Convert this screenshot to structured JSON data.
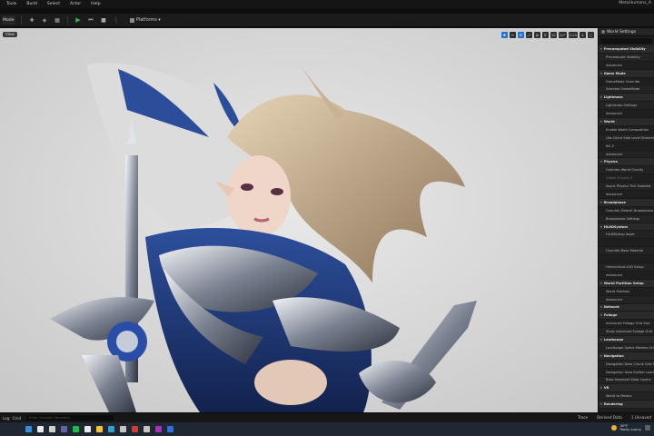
{
  "menubar": {
    "items": [
      "Tools",
      "Build",
      "Select",
      "Actor",
      "Help"
    ],
    "title": "MetaHumans_A"
  },
  "toolbar": {
    "mode_label": "Mode",
    "platforms_label": "Platforms"
  },
  "viewport": {
    "view_label": "View",
    "tools": [
      "10",
      "10°",
      "0.25",
      "4"
    ]
  },
  "panel": {
    "title": "World Settings",
    "rows": [
      {
        "t": "section",
        "label": "Precomputed Visibility"
      },
      {
        "t": "item",
        "label": "Precompute Visibility"
      },
      {
        "t": "item",
        "label": "Advanced"
      },
      {
        "t": "section",
        "label": "Game Mode"
      },
      {
        "t": "item",
        "label": "GameMode Override"
      },
      {
        "t": "item",
        "label": "Selected GameMode"
      },
      {
        "t": "section",
        "label": "Lightmass"
      },
      {
        "t": "item",
        "label": "Lightmass Settings"
      },
      {
        "t": "item",
        "label": "Advanced"
      },
      {
        "t": "section",
        "label": "World"
      },
      {
        "t": "item",
        "label": "Enable World Composition"
      },
      {
        "t": "item",
        "label": "Use Client Side Level Streaming"
      },
      {
        "t": "item",
        "label": "Kill Z"
      },
      {
        "t": "item",
        "label": "Advanced"
      },
      {
        "t": "section",
        "label": "Physics"
      },
      {
        "t": "item",
        "label": "Override World Gravity"
      },
      {
        "t": "item",
        "label": "Global Gravity Z",
        "dim": true
      },
      {
        "t": "item",
        "label": "Async Physics Tick Enabled"
      },
      {
        "t": "item",
        "label": "Advanced"
      },
      {
        "t": "section",
        "label": "Broadphase"
      },
      {
        "t": "item",
        "label": "Override Default Broadphase Se"
      },
      {
        "t": "item",
        "label": "Broadphase Settings"
      },
      {
        "t": "section",
        "label": "HLODSystem"
      },
      {
        "t": "item",
        "label": "HLODSetup Asset"
      },
      {
        "t": "item",
        "label": ""
      },
      {
        "t": "item",
        "label": "Override Base Material"
      },
      {
        "t": "item",
        "label": ""
      },
      {
        "t": "item",
        "label": "Hierarchical LOD Setup"
      },
      {
        "t": "item",
        "label": "Advanced"
      },
      {
        "t": "section",
        "label": "World Partition Setup"
      },
      {
        "t": "item",
        "label": "World Partition"
      },
      {
        "t": "item",
        "label": "Advanced"
      },
      {
        "t": "section",
        "label": "Network"
      },
      {
        "t": "section",
        "label": "Foliage"
      },
      {
        "t": "item",
        "label": "Instanced Foliage Grid Size"
      },
      {
        "t": "item",
        "label": "Show Instanced Foliage Grid"
      },
      {
        "t": "section",
        "label": "Landscape"
      },
      {
        "t": "item",
        "label": "Landscape Spline Meshes Grid"
      },
      {
        "t": "section",
        "label": "Navigation"
      },
      {
        "t": "item",
        "label": "Navigation Data Chunk Grid Size"
      },
      {
        "t": "item",
        "label": "Navigation Data Builder Loadin"
      },
      {
        "t": "item",
        "label": "Base Navmesh Data Layers"
      },
      {
        "t": "section",
        "label": "VR"
      },
      {
        "t": "item",
        "label": "World to Meters"
      },
      {
        "t": "section",
        "label": "Rendering"
      }
    ]
  },
  "statusbar": {
    "log": "Log",
    "cmd": "Cmd",
    "cmd_placeholder": "Enter Console Command",
    "trace": "Trace",
    "derived": "Derived Data",
    "unsaved": "1 Unsaved"
  },
  "taskbar": {
    "temperature": "30°F",
    "weather": "Partly sunny",
    "icons": [
      {
        "name": "windows-start-icon",
        "color": "#3b8ad8"
      },
      {
        "name": "taskbar-search-icon",
        "color": "#e8e8e8"
      },
      {
        "name": "taskview-icon",
        "color": "#d0d0d0"
      },
      {
        "name": "teams-icon",
        "color": "#6264a7"
      },
      {
        "name": "spotify-icon",
        "color": "#1db954"
      },
      {
        "name": "app-icon",
        "color": "#e8e8e8"
      },
      {
        "name": "file-explorer-icon",
        "color": "#f3c13a"
      },
      {
        "name": "edge-icon",
        "color": "#29a3d6"
      },
      {
        "name": "unreal-icon",
        "color": "#c4c4c4"
      },
      {
        "name": "app-icon",
        "color": "#d63a2f"
      },
      {
        "name": "unreal-icon",
        "color": "#c4c4c4"
      },
      {
        "name": "app-icon",
        "color": "#b02bc0"
      },
      {
        "name": "app-icon",
        "color": "#2f6fd6"
      }
    ]
  },
  "colors": {
    "accent": "#2a73c4",
    "play": "#39b54a",
    "viewport_bg": "#d8d8d8"
  }
}
